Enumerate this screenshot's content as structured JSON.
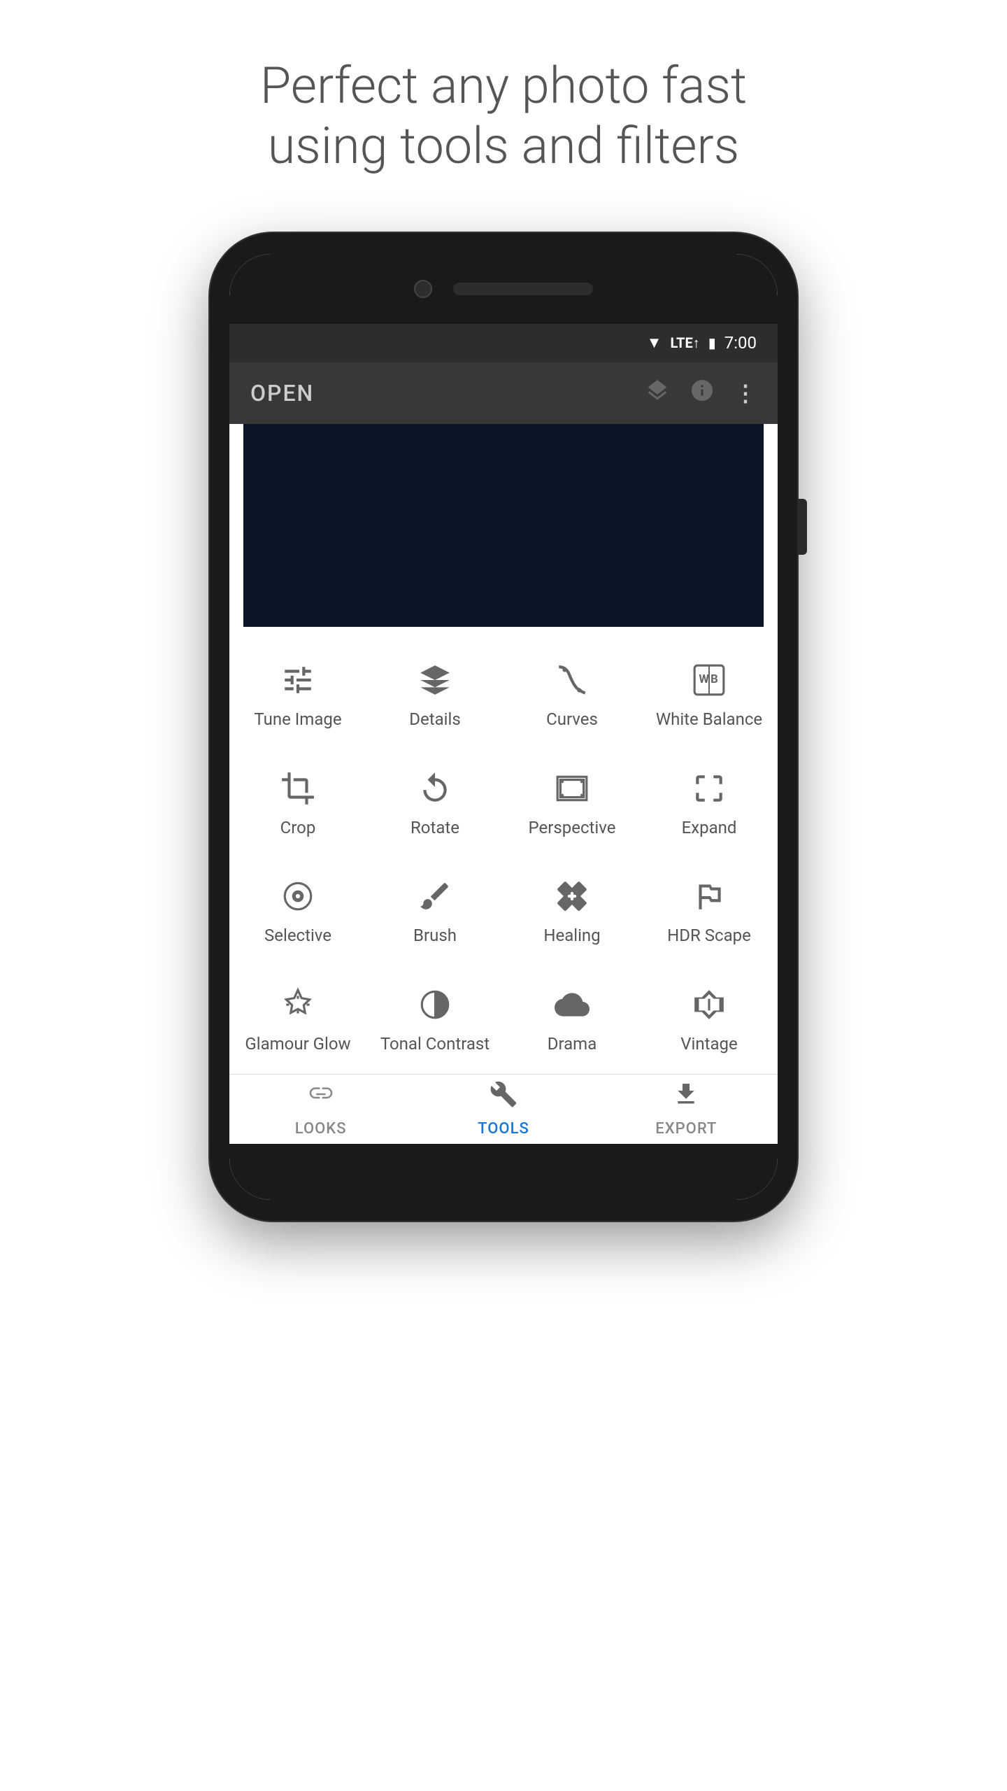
{
  "headline": {
    "line1": "Perfect any photo fast",
    "line2": "using tools and filters"
  },
  "status_bar": {
    "time": "7:00"
  },
  "app_header": {
    "open_label": "OPEN"
  },
  "tools": [
    {
      "id": "tune-image",
      "label": "Tune Image",
      "icon": "tune"
    },
    {
      "id": "details",
      "label": "Details",
      "icon": "details"
    },
    {
      "id": "curves",
      "label": "Curves",
      "icon": "curves"
    },
    {
      "id": "white-balance",
      "label": "White Balance",
      "icon": "wb"
    },
    {
      "id": "crop",
      "label": "Crop",
      "icon": "crop"
    },
    {
      "id": "rotate",
      "label": "Rotate",
      "icon": "rotate"
    },
    {
      "id": "perspective",
      "label": "Perspective",
      "icon": "perspective"
    },
    {
      "id": "expand",
      "label": "Expand",
      "icon": "expand"
    },
    {
      "id": "selective",
      "label": "Selective",
      "icon": "selective"
    },
    {
      "id": "brush",
      "label": "Brush",
      "icon": "brush"
    },
    {
      "id": "healing",
      "label": "Healing",
      "icon": "healing"
    },
    {
      "id": "hdr-scape",
      "label": "HDR Scape",
      "icon": "hdr"
    },
    {
      "id": "glamour-glow",
      "label": "Glamour Glow",
      "icon": "glamour"
    },
    {
      "id": "tonal-contrast",
      "label": "Tonal Contrast",
      "icon": "tonal"
    },
    {
      "id": "drama",
      "label": "Drama",
      "icon": "drama"
    },
    {
      "id": "vintage",
      "label": "Vintage",
      "icon": "vintage"
    }
  ],
  "bottom_nav": [
    {
      "id": "looks",
      "label": "LOOKS",
      "active": false
    },
    {
      "id": "tools",
      "label": "TOOLS",
      "active": true
    },
    {
      "id": "export",
      "label": "EXPORT",
      "active": false
    }
  ]
}
